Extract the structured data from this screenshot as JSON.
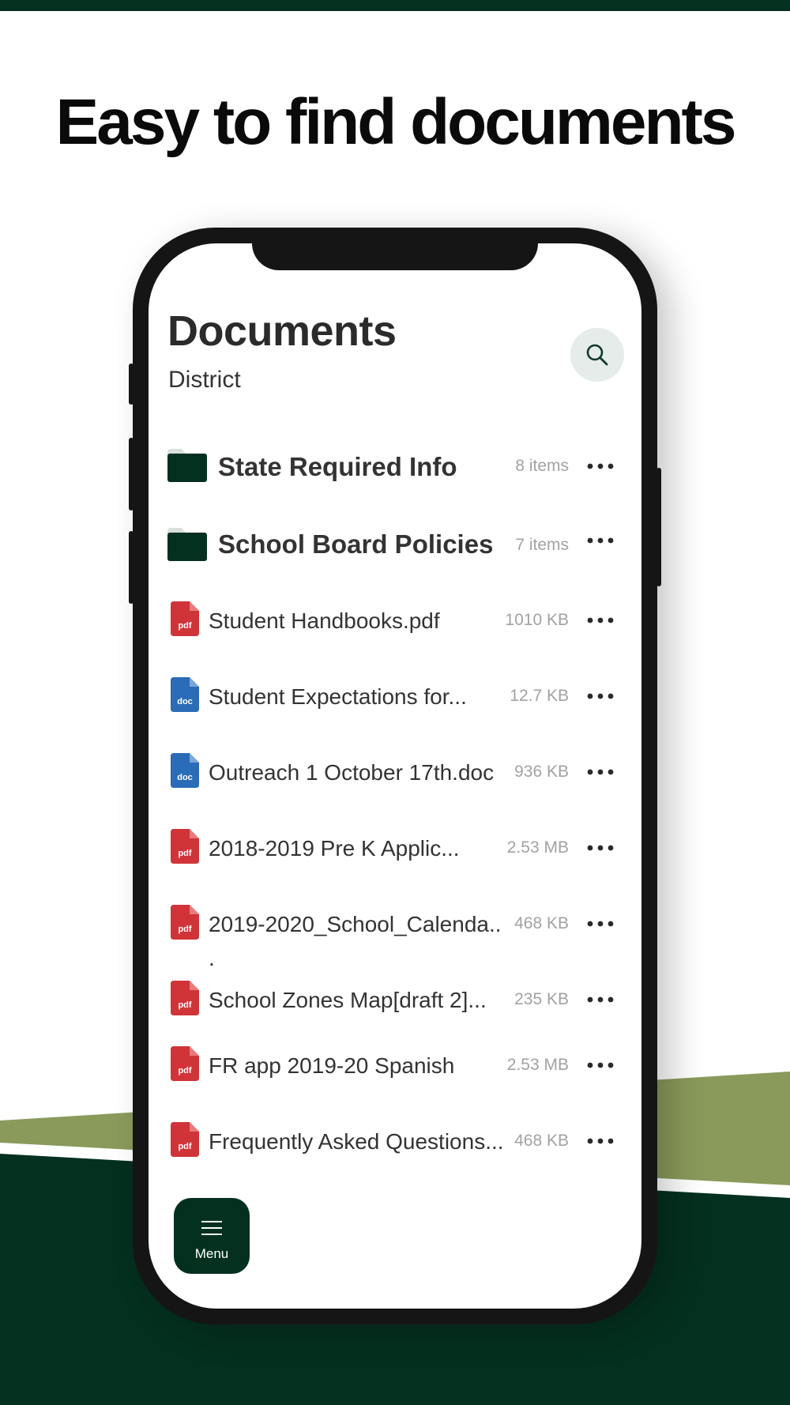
{
  "headline": "Easy to find documents",
  "colors": {
    "brand_dark": "#04301f",
    "brand_olive": "#8a9a5b",
    "pdf_red": "#d13438",
    "doc_blue": "#2b6cb8"
  },
  "screen": {
    "title": "Documents",
    "subtitle": "District",
    "search_icon": "search-icon",
    "folders": [
      {
        "name": "State Required Info",
        "meta": "8 items"
      },
      {
        "name": "School Board Policies",
        "meta": "7 items"
      }
    ],
    "files": [
      {
        "type": "pdf",
        "name": "Student Handbooks.pdf",
        "meta": "1010 KB"
      },
      {
        "type": "doc",
        "name": "Student Expectations for...",
        "meta": "12.7 KB"
      },
      {
        "type": "doc",
        "name": "Outreach 1 October 17th.doc",
        "meta": "936 KB"
      },
      {
        "type": "pdf",
        "name": "2018-2019 Pre K Applic...",
        "meta": "2.53 MB"
      },
      {
        "type": "pdf",
        "name": "2019-2020_School_Calenda..",
        "name_wrap": ".",
        "meta": "468 KB"
      },
      {
        "type": "pdf",
        "name": "School Zones Map[draft 2]...",
        "meta": "235 KB"
      },
      {
        "type": "pdf",
        "name": "FR app 2019-20 Spanish",
        "meta": "2.53 MB"
      },
      {
        "type": "pdf",
        "name": "Frequently Asked Questions...",
        "meta": "468 KB"
      }
    ],
    "menu": {
      "label": "Menu",
      "icon": "hamburger-icon"
    }
  }
}
